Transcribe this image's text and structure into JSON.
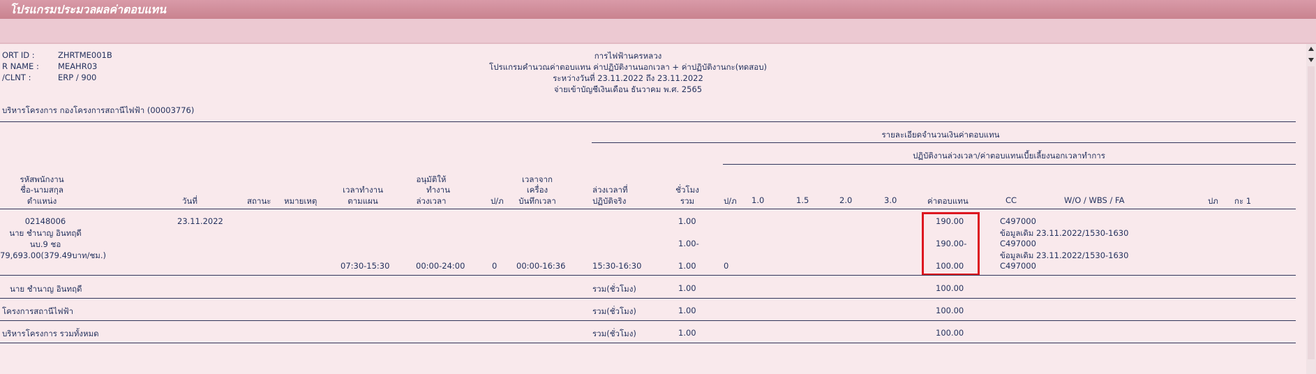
{
  "window": {
    "title": "โปรแกรมประมวลผลค่าตอบแทน"
  },
  "report_header": {
    "left": [
      {
        "label": "ORT ID :",
        "value": "ZHRTME001B"
      },
      {
        "label": "R NAME :",
        "value": "MEAHR03"
      },
      {
        "label": "/CLNT  :",
        "value": "ERP  /  900"
      }
    ],
    "center": [
      "การไฟฟ้านครหลวง",
      "โปรแกรมคำนวณค่าตอบแทน ค่าปฏิบัติงานนอกเวลา + ค่าปฏิบัติงานกะ(ทดสอบ)",
      "ระหว่างวันที่ 23.11.2022 ถึง 23.11.2022",
      "จ่ายเข้าบัญชีเงินเดือน ธันวาคม พ.ศ. 2565"
    ],
    "org_line": "บริหารโครงการ กองโครงการสถานีไฟฟ้า (00003776)"
  },
  "group_headers": {
    "detail": "รายละเอียดจำนวนเงินค่าตอบแทน",
    "ot": "ปฏิบัติงานล่วงเวลา/ค่าตอบแทนเบี้ยเลี้ยงนอกเวลาทำการ"
  },
  "columns": {
    "emp_id": "รหัสพนักงาน",
    "emp_name": "ชื่อ-นามสกุล",
    "emp_pos": "ตำแหน่ง",
    "date": "วันที่",
    "status": "สถานะ",
    "note": "หมายเหตุ",
    "plan_1": "เวลาทำงาน",
    "plan_2": "ตามแผน",
    "appr_1": "อนุมัติให้",
    "appr_2": "ทำงาน",
    "appr_3": "ล่วงเวลา",
    "pr": "ป/ภ",
    "mach_1": "เวลาจาก",
    "mach_2": "เครื่อง",
    "mach_3": "บันทึกเวลา",
    "actual_1": "ล่วงเวลาที่",
    "actual_2": "ปฏิบัติจริง",
    "hours_1": "ชั่วโมง",
    "hours_2": "รวม",
    "pr2": "ป/ภ",
    "r10": "1.0",
    "r15": "1.5",
    "r20": "2.0",
    "r30": "3.0",
    "pay": "ค่าตอบแทน",
    "cc": "CC",
    "wo": "W/O / WBS / FA",
    "pk": "ปภ",
    "shift": "กะ 1"
  },
  "employee": {
    "id": "02148006",
    "date": "23.11.2022",
    "name": "นาย ชำนาญ อินทฤดี",
    "position": "นบ.9 ชอ",
    "salary": "79,693.00(379.49บาท/ชม.)"
  },
  "detail_rows": [
    {
      "hours": "1.00",
      "pay": "190.00",
      "cc": "C497000",
      "note": "ข้อมูลเดิม 23.11.2022/1530-1630"
    },
    {
      "hours": "1.00-",
      "pay": "190.00-",
      "cc": "C497000",
      "note": "ข้อมูลเดิม 23.11.2022/1530-1630"
    },
    {
      "plan": "07:30-15:30",
      "appr": "00:00-24:00",
      "pr": "0",
      "mach": "00:00-16:36",
      "actual": "15:30-16:30",
      "hours": "1.00",
      "pr2": "0",
      "pay": "100.00",
      "cc": "C497000"
    }
  ],
  "summary_rows": [
    {
      "label": "นาย ชำนาญ อินทฤดี",
      "sum_label": "รวม(ชั่วโมง)",
      "hours": "1.00",
      "pay": "100.00"
    },
    {
      "label": "โครงการสถานีไฟฟ้า",
      "sum_label": "รวม(ชั่วโมง)",
      "hours": "1.00",
      "pay": "100.00"
    },
    {
      "label": "บริหารโครงการ รวมทั้งหมด",
      "sum_label": "รวม(ชั่วโมง)",
      "hours": "1.00",
      "pay": "100.00"
    }
  ],
  "colors": {
    "highlight": "#dd1620",
    "titlebar": "#c9838f",
    "text": "#24325e"
  }
}
